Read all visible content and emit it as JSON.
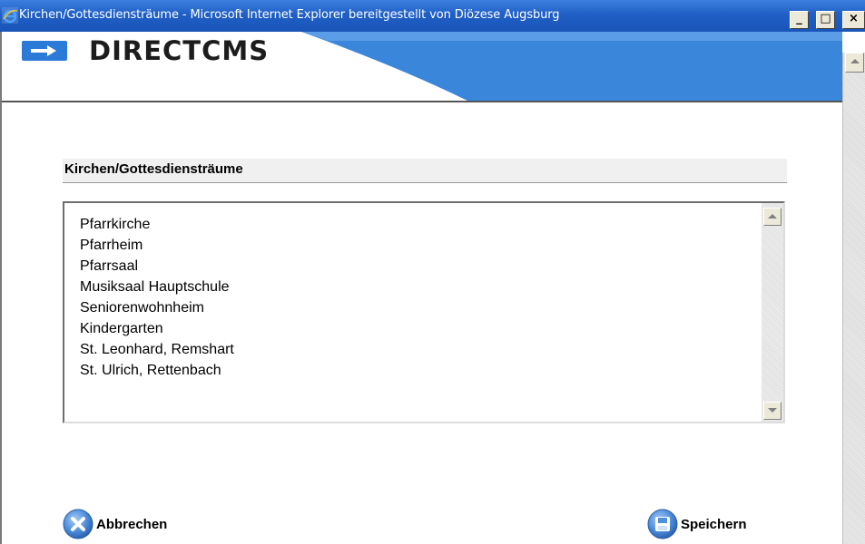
{
  "window": {
    "title": "Kirchen/Gottesdiensträume - Microsoft Internet Explorer bereitgestellt von Diözese Augsburg",
    "controls": {
      "minimize": "_",
      "maximize": "□",
      "close": "×"
    },
    "icon": "internet-explorer-icon"
  },
  "header": {
    "logo_icon": "arrow-right-icon",
    "logo_text": "DIRECTCMS",
    "accent_color": "#2b7ad8"
  },
  "section": {
    "heading": "Kirchen/Gottesdiensträume"
  },
  "list": {
    "items": [
      "Pfarrkirche",
      "Pfarrheim",
      "Pfarrsaal",
      "Musiksaal Hauptschule",
      "Seniorenwohnheim",
      "Kindergarten",
      "St. Leonhard, Remshart",
      "St. Ulrich, Rettenbach"
    ]
  },
  "actions": {
    "cancel": {
      "label": "Abbrechen",
      "icon": "cancel-x-icon"
    },
    "save": {
      "label": "Speichern",
      "icon": "save-disk-icon"
    }
  }
}
